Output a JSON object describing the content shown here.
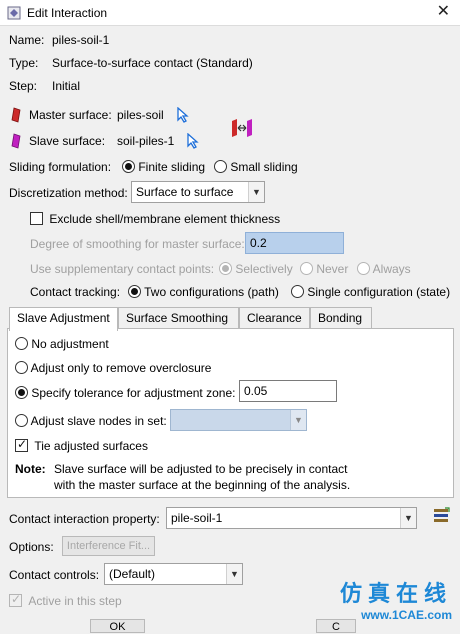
{
  "window": {
    "title": "Edit Interaction"
  },
  "name": {
    "label": "Name:",
    "value": "piles-soil-1"
  },
  "type": {
    "label": "Type:",
    "value": "Surface-to-surface contact (Standard)"
  },
  "step": {
    "label": "Step:",
    "value": "Initial"
  },
  "master": {
    "label": "Master surface:",
    "value": "piles-soil"
  },
  "slave": {
    "label": "Slave surface:",
    "value": "soil-piles-1"
  },
  "sliding": {
    "label": "Sliding formulation:",
    "option1": "Finite sliding",
    "option2": "Small sliding",
    "selected": "Finite sliding"
  },
  "discretization": {
    "label": "Discretization method:",
    "value": "Surface to surface"
  },
  "exclude_shell": {
    "label": "Exclude shell/membrane element thickness",
    "checked": false
  },
  "smoothing": {
    "label": "Degree of smoothing for master surface:",
    "value": "0.2"
  },
  "supplementary": {
    "label": "Use supplementary contact points:",
    "option1": "Selectively",
    "option2": "Never",
    "option3": "Always"
  },
  "tracking": {
    "label": "Contact tracking:",
    "option1": "Two configurations (path)",
    "option2": "Single configuration (state)"
  },
  "tabs": [
    "Slave Adjustment",
    "Surface Smoothing",
    "Clearance",
    "Bonding"
  ],
  "slave_adjustment": {
    "no_adjustment": "No adjustment",
    "overclosure": "Adjust only to remove overclosure",
    "tolerance_label": "Specify tolerance for adjustment zone:",
    "tolerance_value": "0.05",
    "nodes_in_set": "Adjust slave nodes in set:",
    "tie": "Tie adjusted surfaces",
    "note_label": "Note:",
    "note_line1": "Slave surface will be adjusted to be precisely in contact",
    "note_line2": "with the master surface at the beginning of the analysis."
  },
  "property": {
    "label": "Contact interaction property:",
    "value": "pile-soil-1"
  },
  "options": {
    "label": "Options:",
    "button": "Interference Fit..."
  },
  "controls": {
    "label": "Contact controls:",
    "value": "(Default)"
  },
  "active": {
    "label": "Active in this step",
    "checked": true
  },
  "buttons": {
    "ok": "OK",
    "cancel": "C"
  },
  "watermark": {
    "cn": "仿真在线",
    "en": "www.1CAE.com"
  },
  "colors": {
    "master_swatch": "#cc2a2a",
    "slave_swatch": "#c020c0",
    "select_arrow": "#1e6fd9",
    "disabled_combo": "#c9d8ea"
  }
}
